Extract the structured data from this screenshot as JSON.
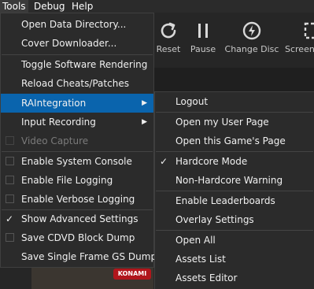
{
  "menubar": {
    "tools": "Tools",
    "debug": "Debug",
    "help": "Help"
  },
  "toolbar": {
    "reset": "Reset",
    "pause": "Pause",
    "change_disc": "Change Disc",
    "screenshot": "Screen"
  },
  "tools_menu": {
    "items": [
      {
        "label": "Open Data Directory..."
      },
      {
        "label": "Cover Downloader..."
      },
      {
        "label": "Toggle Software Rendering"
      },
      {
        "label": "Reload Cheats/Patches"
      },
      {
        "label": "RAIntegration"
      },
      {
        "label": "Input Recording"
      },
      {
        "label": "Video Capture"
      },
      {
        "label": "Enable System Console"
      },
      {
        "label": "Enable File Logging"
      },
      {
        "label": "Enable Verbose Logging"
      },
      {
        "label": "Show Advanced Settings"
      },
      {
        "label": "Save CDVD Block Dump"
      },
      {
        "label": "Save Single Frame GS Dump"
      }
    ]
  },
  "raintegration_menu": {
    "items": [
      {
        "label": "Logout"
      },
      {
        "label": "Open my User Page"
      },
      {
        "label": "Open this Game's Page"
      },
      {
        "label": "Hardcore Mode"
      },
      {
        "label": "Non-Hardcore Warning"
      },
      {
        "label": "Enable Leaderboards"
      },
      {
        "label": "Overlay Settings"
      },
      {
        "label": "Open All"
      },
      {
        "label": "Assets List"
      },
      {
        "label": "Assets Editor"
      }
    ]
  },
  "game_thumb": {
    "badge": "KONAMI"
  },
  "colors": {
    "menu_bg": "#2b2b2b",
    "highlight": "#0a64ad",
    "disabled_text": "#7a7a7a"
  }
}
